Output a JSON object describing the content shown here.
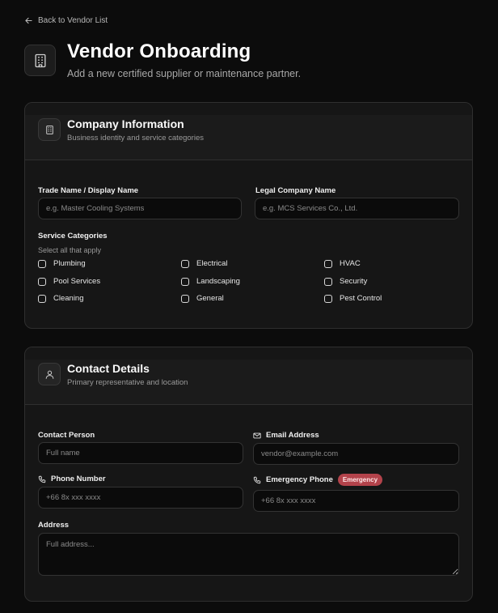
{
  "nav": {
    "back_label": "Back to Vendor List"
  },
  "header": {
    "title": "Vendor Onboarding",
    "subtitle": "Add a new certified supplier or maintenance partner."
  },
  "company": {
    "title": "Company Information",
    "subtitle": "Business identity and service categories",
    "trade_name": {
      "label": "Trade Name / Display Name",
      "placeholder": "e.g. Master Cooling Systems",
      "value": ""
    },
    "legal_name": {
      "label": "Legal Company Name",
      "placeholder": "e.g. MCS Services Co., Ltd.",
      "value": ""
    },
    "categories": {
      "title": "Service Categories",
      "hint": "Select all that apply",
      "items": [
        {
          "label": "Plumbing",
          "checked": false
        },
        {
          "label": "Electrical",
          "checked": false
        },
        {
          "label": "HVAC",
          "checked": false
        },
        {
          "label": "Pool Services",
          "checked": false
        },
        {
          "label": "Landscaping",
          "checked": false
        },
        {
          "label": "Security",
          "checked": false
        },
        {
          "label": "Cleaning",
          "checked": false
        },
        {
          "label": "General",
          "checked": false
        },
        {
          "label": "Pest Control",
          "checked": false
        }
      ]
    }
  },
  "contact": {
    "title": "Contact Details",
    "subtitle": "Primary representative and location",
    "person": {
      "label": "Contact Person",
      "placeholder": "Full name",
      "value": ""
    },
    "email": {
      "label": "Email Address",
      "placeholder": "vendor@example.com",
      "value": ""
    },
    "phone": {
      "label": "Phone Number",
      "placeholder": "+66 8x xxx xxxx",
      "value": ""
    },
    "emergency_phone": {
      "label": "Emergency Phone",
      "badge": "Emergency",
      "placeholder": "+66 8x xxx xxxx",
      "value": ""
    },
    "address": {
      "label": "Address",
      "placeholder": "Full address...",
      "value": ""
    }
  },
  "colors": {
    "background": "#0c0c0c",
    "card": "#161616",
    "badge": "#b3434b"
  }
}
